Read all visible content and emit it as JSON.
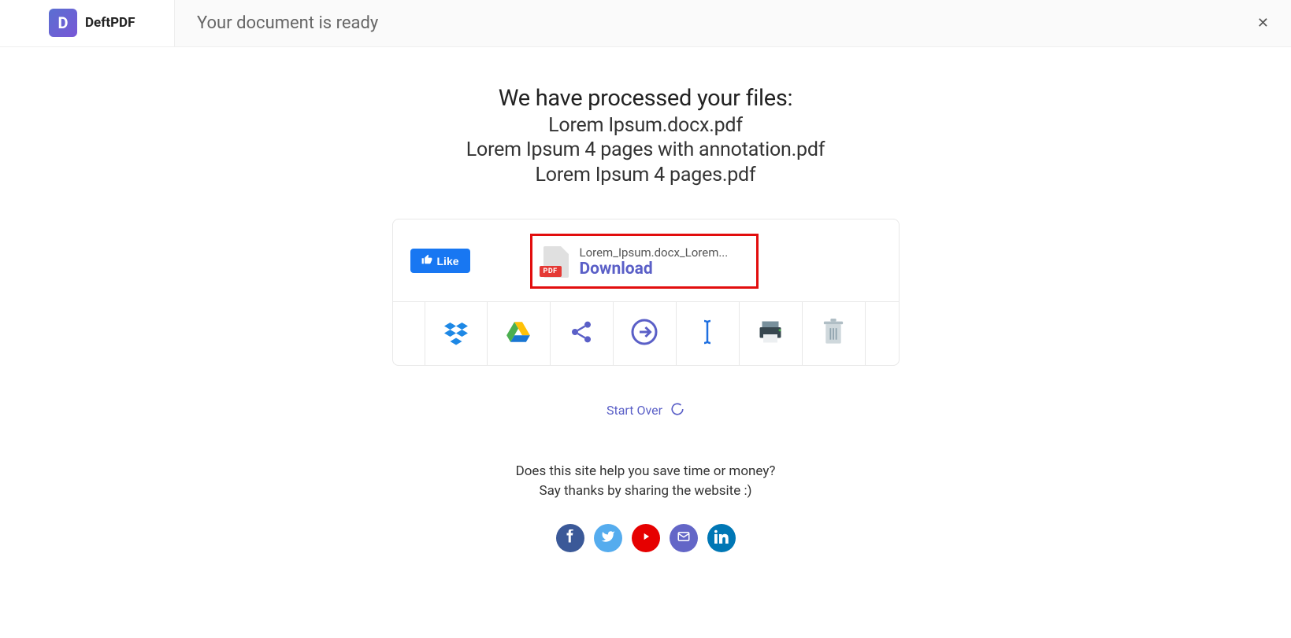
{
  "brand": {
    "logo_letter": "D",
    "name": "DeftPDF"
  },
  "header": {
    "title": "Your document is ready"
  },
  "main": {
    "processed_heading": "We have processed your files:",
    "files": [
      "Lorem Ipsum.docx.pdf",
      "Lorem Ipsum 4 pages with annotation.pdf",
      "Lorem Ipsum 4 pages.pdf"
    ],
    "like_button": "Like",
    "download": {
      "filename": "Lorem_Ipsum.docx_Lorem...",
      "label": "Download",
      "badge": "PDF"
    },
    "actions": {
      "dropbox": "dropbox-icon",
      "google_drive": "google-drive-icon",
      "share": "share-icon",
      "export": "arrow-circle-icon",
      "rename": "text-cursor-icon",
      "print": "printer-icon",
      "delete": "trash-icon"
    },
    "start_over": "Start Over"
  },
  "footer": {
    "line1": "Does this site help you save time or money?",
    "line2": "Say thanks by sharing the website :)",
    "social": {
      "facebook": "facebook",
      "twitter": "twitter",
      "youtube": "youtube",
      "email": "email",
      "linkedin": "linkedin"
    }
  }
}
